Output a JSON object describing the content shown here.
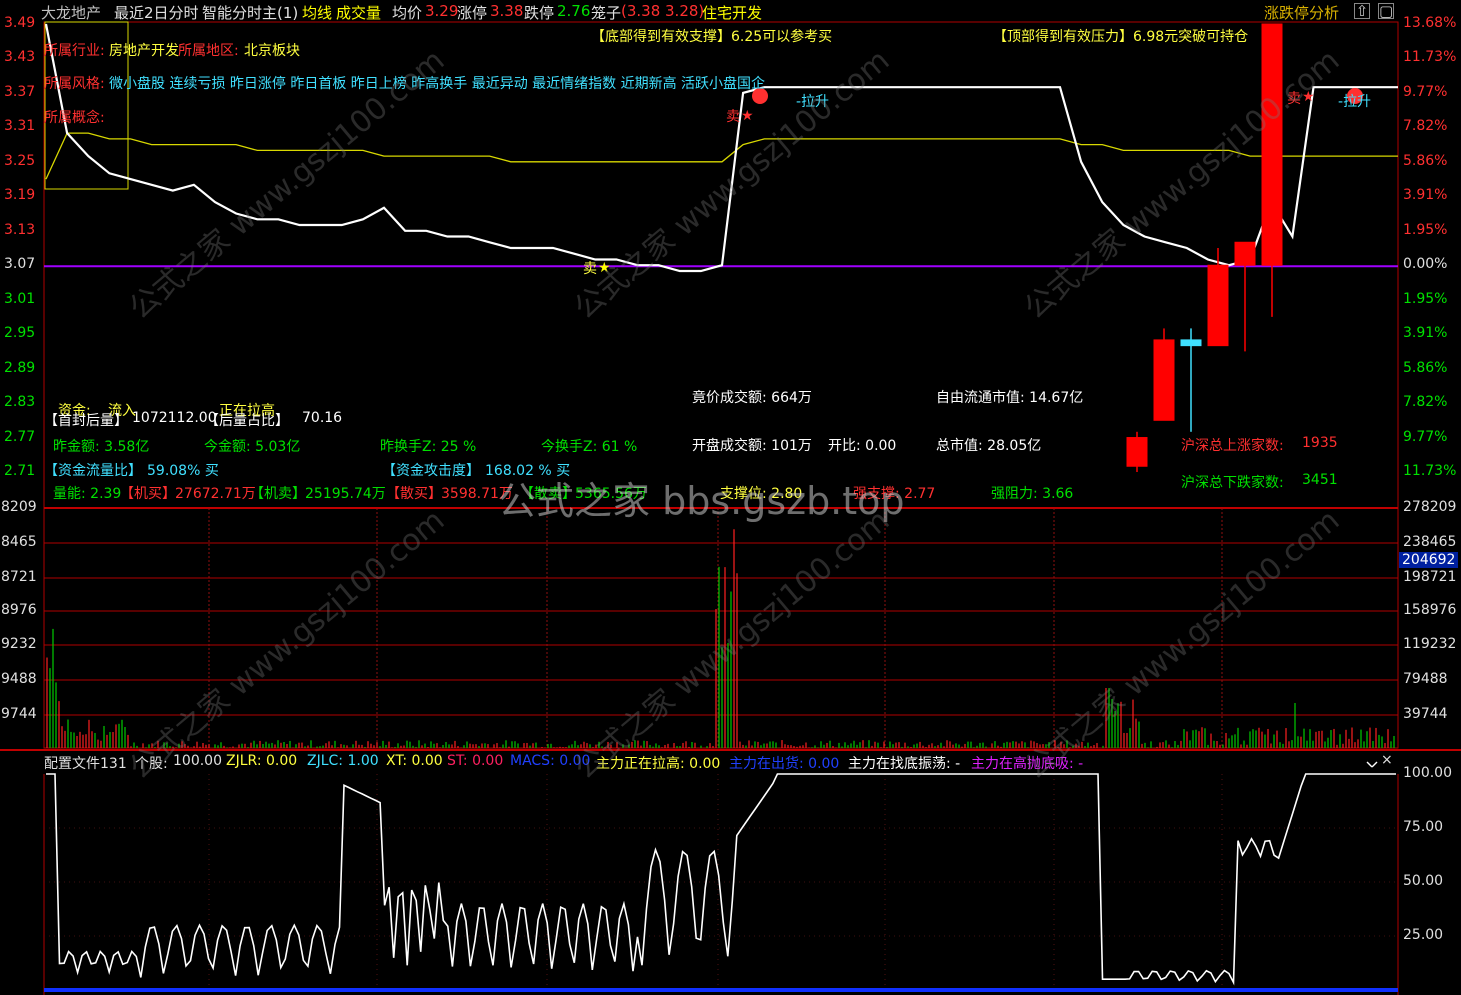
{
  "title_bar": {
    "stock_name": "大龙地产",
    "period": "最近2日分时",
    "formula": "智能分时主(1)",
    "avg_line": "均线",
    "volume": "成交量",
    "avg_price_label": "均价",
    "avg_price_value": "3.29",
    "limit_up_label": "涨停",
    "limit_up_value": "3.38",
    "limit_down_label": "跌停",
    "limit_down_value": "2.76",
    "cage_label": "笼子",
    "cage_values": "(3.38 3.28)",
    "sector": "住宅开发",
    "right_button": "涨跌停分析"
  },
  "price_axis_left": [
    "3.49",
    "3.43",
    "3.37",
    "3.31",
    "3.25",
    "3.19",
    "3.13",
    "3.07",
    "3.01",
    "2.95",
    "2.89",
    "2.83",
    "2.77",
    "2.71"
  ],
  "price_axis_right": [
    "13.68%",
    "11.73%",
    "9.77%",
    "7.82%",
    "5.86%",
    "3.91%",
    "1.95%",
    "0.00%",
    "1.95%",
    "3.91%",
    "5.86%",
    "7.82%",
    "9.77%",
    "11.73%"
  ],
  "volume_axis_left": [
    "8209",
    "8465",
    "8721",
    "8976",
    "9232",
    "9488",
    "9744"
  ],
  "volume_axis_right": [
    "278209",
    "238465",
    "198721",
    "158976",
    "119232",
    "79488",
    "39744"
  ],
  "volume_current": "204692",
  "indicator_axis_right": [
    "100.00",
    "75.00",
    "50.00",
    "25.00"
  ],
  "overlay": {
    "industry_label": "所属行业:",
    "industry_value": "房地产开发",
    "region_label": "所属地区:",
    "region_value": "北京板块",
    "style_label": "所属风格:",
    "style_value": "微小盘股 连续亏损 昨日涨停 昨日首板 昨日上榜 昨高换手 最近异动 最近情绪指数 近期新高 活跃小盘国企",
    "concept_label": "所属概念:",
    "bottom_support": "【底部得到有效支撑】6.25可以参考买",
    "top_pressure": "【顶部得到有效压力】6.98元突破可持仓",
    "sell_label": "卖",
    "pull_label": "拉升",
    "fund_label": "资金:",
    "fund_value": "流入",
    "pulling_text": "正在拉高",
    "first_seal_label": "【首封后量】",
    "first_seal_value": "1072112.00",
    "after_ratio_label": "【后量占比】",
    "after_ratio_value": "70.16",
    "yesterday_amount": "昨金额: 3.58亿",
    "today_amount": "今金额: 5.03亿",
    "yesterday_turnover": "昨换手Z: 25 %",
    "today_turnover": "今换手Z: 61 %",
    "flow_ratio_label": "【资金流量比】",
    "flow_ratio_value": "59.08% 买",
    "attack_label": "【资金攻击度】",
    "attack_value": "168.02 % 买",
    "vol_energy": "量能: 2.39",
    "inst_buy_label": "【机买】",
    "inst_buy_value": "27672.71万",
    "inst_sell_label": "【机卖】",
    "inst_sell_value": "25195.74万",
    "retail_buy_label": "【散买】",
    "retail_buy_value": "3598.71万",
    "retail_sell_label": "【散卖】",
    "retail_sell_value": "5365.56万",
    "support_level": "支撑位: 2.80",
    "strong_support": "强支撑: 2.77",
    "strong_resist": "强阻力: 3.66",
    "auction_amount": "竟价成交额: 664万",
    "free_cap": "自由流通市值: 14.67亿",
    "open_amount": "开盘成交额: 101万",
    "open_ratio": "开比: 0.00",
    "total_cap": "总市值: 28.05亿",
    "up_count_label": "沪深总上涨家数:",
    "up_count": "1935",
    "down_count_label": "沪深总下跌家数:",
    "down_count": "3451"
  },
  "indicator_bar": {
    "config": "配置文件131",
    "stock_label": "个股:",
    "stock_value": "100.00",
    "zjlr": "ZJLR: 0.00",
    "zjlc": "ZJLC: 1.00",
    "xt": "XT: 0.00",
    "st": "ST: 0.00",
    "macs": "MACS: 0.00",
    "pulling": "主力正在拉高: 0.00",
    "shipping": "主力在出货: 0.00",
    "bottom_shake": "主力在找底振荡: -",
    "high_absorb": "主力在高抛底吸: -"
  },
  "watermark": "公式之家 bbs.gszb.top",
  "watermark_diag": "公式之家 www.gszj100.com",
  "colors": {
    "price_line": "#ffffff",
    "avg_line": "#d8d800",
    "zero_line": "#a000ff",
    "grid": "#b00000",
    "up": "#ff0000",
    "down": "#00cc00",
    "cyan": "#40e0ff"
  },
  "chart_data": {
    "type": "line",
    "title": "",
    "xlabel": "",
    "ylabel": "",
    "ylim": [
      2.71,
      3.49
    ],
    "series": [
      {
        "values": [
          3.49,
          3.3,
          3.26,
          3.23,
          3.22,
          3.21,
          3.2,
          3.21,
          3.18,
          3.16,
          3.15,
          3.15,
          3.14,
          3.14,
          3.14,
          3.15,
          3.17,
          3.13,
          3.13,
          3.12,
          3.12,
          3.11,
          3.1,
          3.1,
          3.1,
          3.09,
          3.08,
          3.08,
          3.07,
          3.07,
          3.06,
          3.06,
          3.07,
          3.37,
          3.38,
          3.38,
          3.38,
          3.38,
          3.38,
          3.38,
          3.38,
          3.38,
          3.38,
          3.38,
          3.38,
          3.38,
          3.38,
          3.38,
          3.38,
          3.25,
          3.18,
          3.14,
          3.12,
          3.11,
          3.1,
          3.08,
          3.07,
          3.08,
          3.18,
          3.12,
          3.38,
          3.38,
          3.38,
          3.38,
          3.38
        ]
      },
      {
        "values": [
          3.22,
          3.3,
          3.3,
          3.29,
          3.29,
          3.28,
          3.28,
          3.28,
          3.28,
          3.28,
          3.27,
          3.27,
          3.27,
          3.27,
          3.27,
          3.27,
          3.26,
          3.26,
          3.26,
          3.26,
          3.26,
          3.26,
          3.25,
          3.25,
          3.25,
          3.25,
          3.25,
          3.25,
          3.25,
          3.25,
          3.25,
          3.25,
          3.25,
          3.28,
          3.29,
          3.29,
          3.29,
          3.29,
          3.29,
          3.29,
          3.29,
          3.29,
          3.29,
          3.29,
          3.29,
          3.29,
          3.29,
          3.29,
          3.29,
          3.28,
          3.28,
          3.27,
          3.27,
          3.27,
          3.27,
          3.27,
          3.27,
          3.26,
          3.26,
          3.26,
          3.26,
          3.26,
          3.26,
          3.26,
          3.26
        ]
      }
    ],
    "candles": [
      {
        "open": 2.72,
        "close": 2.77,
        "high": 2.78,
        "low": 2.71
      },
      {
        "open": 2.8,
        "close": 2.94,
        "high": 2.96,
        "low": 2.8
      },
      {
        "open": 2.94,
        "close": 2.93,
        "high": 2.96,
        "low": 2.78
      },
      {
        "open": 2.93,
        "close": 3.07,
        "high": 3.1,
        "low": 2.93
      },
      {
        "open": 3.07,
        "close": 3.11,
        "high": 3.11,
        "low": 2.92
      },
      {
        "open": 3.07,
        "close": 3.49,
        "high": 3.49,
        "low": 2.98
      }
    ]
  }
}
